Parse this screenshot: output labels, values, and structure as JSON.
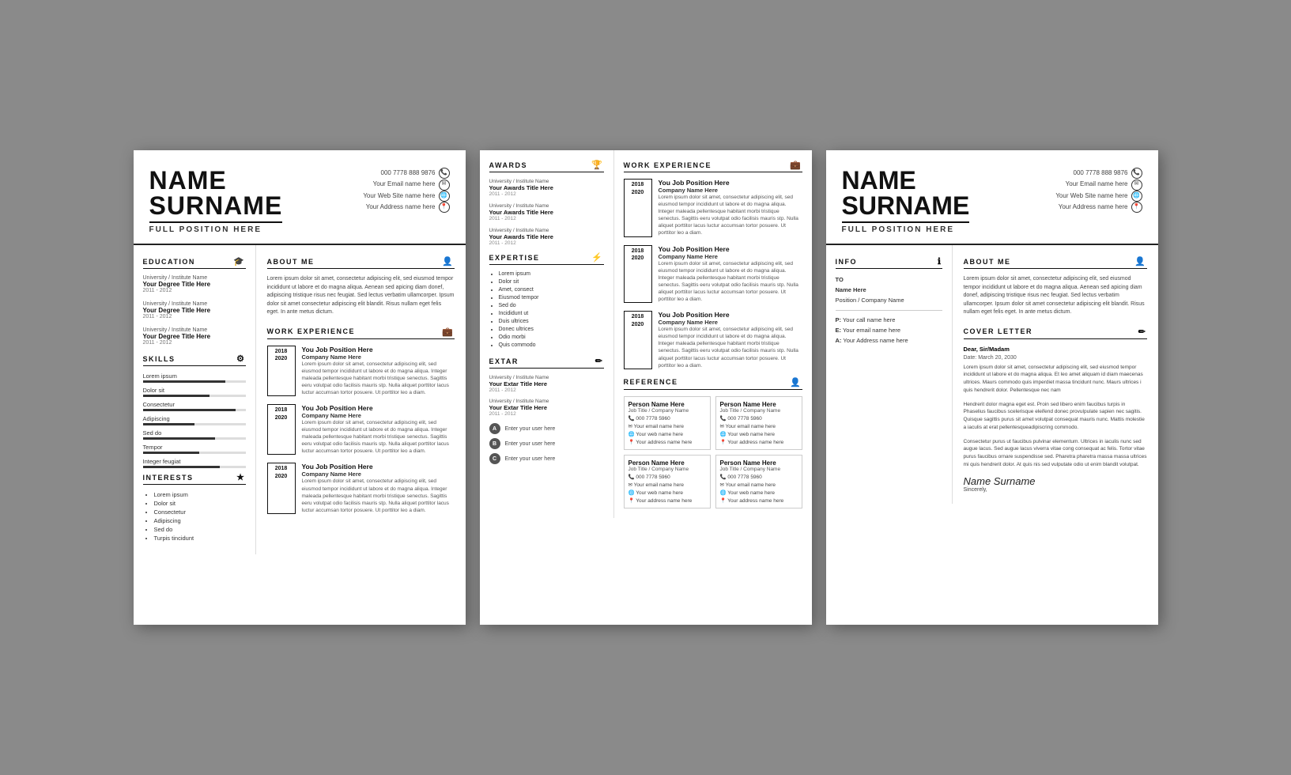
{
  "card1": {
    "name_line1": "NAME",
    "name_line2": "SURNAME",
    "position": "FULL POSITION HERE",
    "contact": {
      "phone": "000 7778 888 9876",
      "email": "Your Email name here",
      "website": "Your Web Site name here",
      "address": "Your Address name here"
    },
    "education_title": "EDUCATION",
    "education_entries": [
      {
        "inst": "University / Institute Name",
        "degree": "Your Degree Title Here",
        "years": "2011 - 2012"
      },
      {
        "inst": "University / Institute Name",
        "degree": "Your Degree Title Here",
        "years": "2011 - 2012"
      },
      {
        "inst": "University / Institute Name",
        "degree": "Your Degree Title Here",
        "years": "2011 - 2012"
      }
    ],
    "skills_title": "SKILLS",
    "skills": [
      {
        "label": "Lorem ipsum",
        "pct": 80
      },
      {
        "label": "Dolor sit",
        "pct": 65
      },
      {
        "label": "Consectetur",
        "pct": 90
      },
      {
        "label": "Adipiscing",
        "pct": 50
      },
      {
        "label": "Sed do",
        "pct": 70
      },
      {
        "label": "Tempor",
        "pct": 55
      },
      {
        "label": "Integer feugiat",
        "pct": 75
      }
    ],
    "interests_title": "INTERESTS",
    "interests": [
      "Lorem ipsum",
      "Dolor sit",
      "Consectetur",
      "Adipiscing",
      "Sed do",
      "Turpis tincidunt"
    ],
    "about_title": "ABOUT ME",
    "about_text": "Lorem ipsum dolor sit amet, consectetur adipiscing elit, sed eiusmod tempor incididunt ut labore et do magna aliqua. Aenean sed apicing diam donef, adipiscing tristique risus nec feugiat. Sed lectus verbatim ullamcorper. Ipsum dolor sit amet consectetur adipiscing elit blandit. Risus nullam eget felis eget. In ante metus dictum.",
    "work_title": "WORK EXPERIENCE",
    "work_entries": [
      {
        "year_start": "2018",
        "year_end": "2020",
        "title": "You Job Position Here",
        "company": "Company Name Here",
        "desc": "Lorem ipsum dolor sit amet, consectetur adipiscing elit, sed eiusmod tempor incididunt ut labore et do magna aliqua. Integer maleada pellentesque habitant morbi tristique senectus. Sagittis eeru volutpat odio facilisis mauris stp. Nulla aliquet porttitor lacus luctur accumsan tortor posuere. Ut porttitor leo a diam."
      },
      {
        "year_start": "2018",
        "year_end": "2020",
        "title": "You Job Position Here",
        "company": "Company Name Here",
        "desc": "Lorem ipsum dolor sit amet, consectetur adipiscing elit, sed eiusmod tempor incididunt ut labore et do magna aliqua. Integer maleada pellentesque habitant morbi tristique senectus. Sagittis eeru volutpat odio facilisis mauris stp. Nulla aliquet porttitor lacus luctur accumsan tortor posuere. Ut porttitor leo a diam."
      },
      {
        "year_start": "2018",
        "year_end": "2020",
        "title": "You Job Position Here",
        "company": "Company Name Here",
        "desc": "Lorem ipsum dolor sit amet, consectetur adipiscing elit, sed eiusmod tempor incididunt ut labore et do magna aliqua. Integer maleada pellentesque habitant morbi tristique senectus. Sagittis eeru volutpat odio facilisis mauris stp. Nulla aliquet porttitor lacus luctur accumsan tortor posuere. Ut porttitor leo a diam."
      }
    ]
  },
  "card2": {
    "awards_title": "AWARDS",
    "awards": [
      {
        "inst": "University / Institute Name",
        "title": "Your Awards Title Here",
        "years": "2011 - 2012"
      },
      {
        "inst": "University / Institute Name",
        "title": "Your Awards Title Here",
        "years": "2011 - 2012"
      },
      {
        "inst": "University / Institute Name",
        "title": "Your Awards Title Here",
        "years": "2011 - 2012"
      }
    ],
    "expertise_title": "EXPERTISE",
    "expertise": [
      "Lorem ipsum",
      "Dolor sit",
      "Amet, consect",
      "Eiusmod tempor",
      "Sed do",
      "Incididunt ut",
      "Duis ultrices",
      "Donec ultrices",
      "Odio morbi",
      "Quis commodo"
    ],
    "extar_title": "EXTAR",
    "extar_entries": [
      {
        "inst": "University / Institute Name",
        "title": "Your Extar Title Here",
        "years": "2011 - 2012"
      },
      {
        "inst": "University / Institute Name",
        "title": "Your Extar Title Here",
        "years": "2011 - 2012"
      }
    ],
    "social_items": [
      {
        "badge": "A",
        "text": "Enter your user here"
      },
      {
        "badge": "B",
        "text": "Enter your user here"
      },
      {
        "badge": "C",
        "text": "Enter your user here"
      }
    ],
    "work_title": "WORK EXPERIENCE",
    "work_entries": [
      {
        "year_start": "2018",
        "year_end": "2020",
        "title": "You Job Position Here",
        "company": "Company Name Here",
        "desc": "Lorem ipsum dolor sit amet, consectetur adipiscing elit, sed eiusmod tempor incididunt ut labore et do magna aliqua. Integer maleada pellentesque habitant morbi tristique senectus. Sagittis eeru volutpat odio facilisis mauris stp. Nulla aliquet porttitor lacus luctur accumsan tortor posuere. Ut porttitor leo a diam."
      },
      {
        "year_start": "2018",
        "year_end": "2020",
        "title": "You Job Position Here",
        "company": "Company Name Here",
        "desc": "Lorem ipsum dolor sit amet, consectetur adipiscing elit, sed eiusmod tempor incididunt ut labore et do magna aliqua. Integer maleada pellentesque habitant morbi tristique senectus. Sagittis eeru volutpat odio facilisis mauris stp. Nulla aliquet porttitor lacus luctur accumsan tortor posuere. Ut porttitor leo a diam."
      },
      {
        "year_start": "2018",
        "year_end": "2020",
        "title": "You Job Position Here",
        "company": "Company Name Here",
        "desc": "Lorem ipsum dolor sit amet, consectetur adipiscing elit, sed eiusmod tempor incididunt ut labore et do magna aliqua. Integer maleada pellentesque habitant morbi tristique senectus. Sagittis eeru volutpat odio facilisis mauris stp. Nulla aliquet porttitor lacus luctur accumsan tortor posuere. Ut porttitor leo a diam."
      }
    ],
    "reference_title": "REFERENCE",
    "references": [
      {
        "name": "Person Name Here",
        "job": "Job Title / Company Name",
        "phone": "000 7778 5960",
        "email": "Your email name here",
        "web": "Your web name here",
        "address": "Your address name here"
      },
      {
        "name": "Person Name Here",
        "job": "Job Title / Company Name",
        "phone": "000 7778 5960",
        "email": "Your email name here",
        "web": "Your web name here",
        "address": "Your address name here"
      },
      {
        "name": "Person Name Here",
        "job": "Job Title / Company Name",
        "phone": "000 7778 5960",
        "email": "Your email name here",
        "web": "Your web name here",
        "address": "Your address name here"
      },
      {
        "name": "Person Name Here",
        "job": "Job Title / Company Name",
        "phone": "000 7778 5960",
        "email": "Your email name here",
        "web": "Your web name here",
        "address": "Your address name here"
      }
    ]
  },
  "card3": {
    "name_line1": "NAME",
    "name_line2": "SURNAME",
    "position": "FULL POSITION HERE",
    "contact": {
      "phone": "000 7778 888 9876",
      "email": "Your Email name here",
      "website": "Your Web Site name here",
      "address": "Your Address name here"
    },
    "info_title": "INFO",
    "info": {
      "to_label": "TO",
      "name": "Name Here",
      "position": "Position / Company Name",
      "phone_label": "P:",
      "phone": "Your call name here",
      "email_label": "E:",
      "email": "Your email name here",
      "address_label": "A:",
      "address": "Your Address name here"
    },
    "about_title": "ABOUT ME",
    "about_text": "Lorem ipsum dolor sit amet, consectetur adipiscing elit, sed eiusmod tempor incididunt ut labore et do magna aliqua. Aenean sed apicing diam donef, adipiscing tristique risus nec feugiat. Sed lectus verbatim ullamcorper. Ipsum dolor sit amet consectetur adipiscing elit blandit. Risus nullam eget felis eget. In ante metus dictum.",
    "cover_letter_title": "COVER LETTER",
    "salutation": "Dear, Sir/Madam",
    "date_label": "Date:",
    "date": "March 20, 2030",
    "cover_paragraphs": [
      "Lorem ipsum dolor sit amet, consectetur adipiscing elit, sed eiusmod tempor incididunt ut labore et do magna aliqua. Et leo amet aliquam id diam maecenas ultrices. Maurs commodo quis imperdiet massa tincidunt nunc. Maurs ultrices i quis hendrerit dolor. Pellentesque nec nam",
      "Hendrerit dolor magna eget est. Proin sed libero enim faucibus turpis in Phaselius faucibus scelerisque eleifend donec provulpulate sapien nec sagitis. Quisque sagittis purus sit amet volutpat consequat mauris nunc. Mattis molestie a iaculis at erat pellentesqueadipiscring commodo.",
      "Consectetur purus ut faucibus pulvinar elementum. Ultrices in iaculis nunc sed augue lacus. Sed augue lacus viverra vitae cong consequat ac felis. Tortor vitae purus faucibus ornare suspendisse sed. Pharetra pharetra massa massa ultrices mi quis hendrerit dolor. At quis nis sed vulputate odio ut enim blandit volutpat."
    ],
    "signature_name": "Name Surname",
    "sincerely": "Sincerely,"
  }
}
